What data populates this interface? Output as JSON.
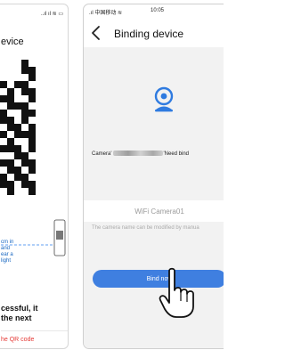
{
  "left_screen": {
    "status_icons": "..ıl ıl ≋ ▭",
    "title": "evice",
    "scan_lines": [
      "cm in",
      "and",
      "ear a",
      "light"
    ],
    "success_lines": [
      "cessful, it",
      "the next"
    ],
    "qr_link": "he QR code"
  },
  "right_screen": {
    "status_carrier": ".ıl 中国移动 ≋",
    "status_time": "10:05",
    "nav": {
      "back_icon": "chevron-left-icon",
      "title": "Binding device"
    },
    "camera_icon": "camera-icon",
    "camera_line": {
      "prefix": "Camera'",
      "suffix": "'Need bind"
    },
    "name_field": {
      "value": "WiFi Camera01",
      "placeholder": "WiFi Camera01"
    },
    "hint": "The camera name can be modified by manua",
    "bind_button": "Bind now",
    "hand_icon": "pointing-hand-icon"
  },
  "colors": {
    "accent": "#3f7fe0",
    "link_red": "#e53935",
    "instruction_blue": "#1565c0",
    "content_bg": "#f2f2f2"
  }
}
